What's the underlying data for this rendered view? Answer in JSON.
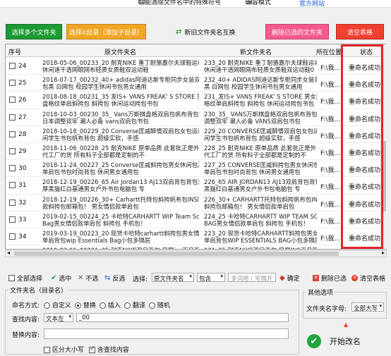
{
  "topbar": {
    "title": "智能清除文件名中的特殊符号",
    "compat_mode": "兼容模式",
    "official": "官方网站"
  },
  "buttons": {
    "select_multi_folders": "选择多个文件夹",
    "select_x_dir": "选择X目录（添加子目录）",
    "swap_old_new": "新旧文件夹名互换",
    "delete_selected": "删除已选的文件夹",
    "clear_table": "清空表格"
  },
  "table": {
    "headers": {
      "seq": "序号",
      "original": "原文件夹名",
      "new": "新文件夹名",
      "location": "所在位置",
      "status": "状态"
    },
    "rows": [
      {
        "num": "24",
        "orig1": "2018-05-06_00233_20 耐克NIKE 重丁耐骆嘉尔夫球鞋运动",
        "orig2": "休闲速干透网眼网布轻质女质鞋双运动鞋",
        "new1": "233_20 耐克NIKE 重丁耐骆嘉尔夫球鞋运动",
        "new2": "休闲速干透网眼网布轻质女质鞋双运动鞋0",
        "pos": "F:\\我...",
        "status": "重命名成功"
      },
      {
        "num": "25",
        "orig1": "2018-07-17_00232_40+ adidas阿迪达斯专柜同步女装双肩",
        "orig2": "包黑 白网包 校园学生休闲书包男女通用",
        "new1": "232_40+ ADIDAS阿迪达斯专柜同步女装双肩包",
        "new2": "黑 白网包 校园学生休闲书包男女通用",
        "pos": "F:\\我...",
        "status": "重命名成功"
      },
      {
        "num": "26",
        "orig1": "2018-08-18_00231_35 发IS+ VANS FREAK' S STORE 男女款棋",
        "orig2": "盘格纹单肩斜挎包 斜挎包 休闲运动挎包书包",
        "new1": "231_发IS+ VANS FREAK' S STORE 男女款棋盘",
        "new2": "格纹单肩斜挎包 斜挎包 休闲运动挎包书包",
        "pos": "F:\\我...",
        "status": "重命名成功"
      },
      {
        "num": "27",
        "orig1": "2018-10-03_00230_35_ Vans万斯棋盘格双肩包帆布背包",
        "orig2": "日本调整双牢 潮人必备 vans双肩包书包",
        "new1": "230_35_ VANS万斯棋盘格双肩包帆布背包日本",
        "new2": "调整双牢 潮人必备 VANS双肩包书包",
        "pos": "F:\\我...",
        "status": "重命名成功"
      },
      {
        "num": "28",
        "orig1": "2018-10-18_00229_20 Converse匡威醉情双肩包女包运动休",
        "orig2": "闲学生书包帆布背包 超级实软，手感",
        "new1": "229_20 CONVERSE匡威醉情双肩包女包运动休",
        "new2": "闲学生书包帆布背包 超级实软，手感",
        "pos": "F:\\我...",
        "status": "重命名成功"
      },
      {
        "num": "29",
        "orig1": "2018-11-06_00228_25 耐克NIKE 原单品质 此套批正是外贸",
        "orig2": "代工厂的货 所有料子全部都是定制的不",
        "new1": "228_25 耐克NIKE 原单品质 此套批正是外贸",
        "new2": "代工厂的货 所有料子全部都是定制的不",
        "pos": "F:\\我...",
        "status": "重命名成功"
      },
      {
        "num": "30",
        "orig1": "2018-11-24_00227_25 Converse匡威斜挎包男女休闲包潮款",
        "orig2": "单肩包书包时尚背包 休闲男女通用包",
        "new1": "227_25 CONVERSE匡威斜挎包男女休闲包潮款",
        "new2": "单肩包书包时尚背包 休闲男女通用包",
        "pos": "F:\\我...",
        "status": "重命名成功"
      },
      {
        "num": "31",
        "orig1": "2018-12-19_00226_65 Air Jordan13 AJ13双肩背包背包双加",
        "orig2": "厚黑猫红白基通男女户外书包电脑包 专",
        "new1": "226_65 AIR JORDAN13 AJ13双肩背包背包双加厚",
        "new2": "黑猫红白基通男女户外书包电脑包 专",
        "pos": "F:\\我...",
        "status": "重命名成功"
      },
      {
        "num": "32",
        "orig1": "2018-12-19_00226_30+ Carhartt托特包斜挎帆布包INS同",
        "orig2": "款斜挎包邮箱包！ 男女情侣款单肩包",
        "new1": "226_30+ CARHARTT托特包斜挎帆布包INS同款",
        "new2": "斜挎包邮箱包！ 男女情侣款单肩包",
        "pos": "F:\\我...",
        "status": "重命名成功"
      },
      {
        "num": "33",
        "orig1": "2019-02-15_00224_25 卡哈特CARHARTT WIP Team Scrip",
        "orig2": "Bag男女情侣款单肩包 斜挎包 手机包！",
        "new1": "224_25 卡哈特CARHARTT WIP TEAM SCRIP",
        "new2": "BAG男女情侣款单肩包 斜挎包 手机包！",
        "pos": "F:\\我...",
        "status": "重命名成功"
      },
      {
        "num": "34",
        "orig1": "2019-03-19_00223_20 现货卡哈特carhartt斜挎包男女情侣",
        "orig2": "单肩背包wip Essentials Bag小包多隔层",
        "new1": "223_20 现货卡哈特CARHARTT斜挎包男女情侣",
        "new2": "单肩背包WIP ESSENTIALS BAG小包多隔层",
        "pos": "F:\\我...",
        "status": "重命名成功"
      },
      {
        "num": "35",
        "orig1": "2019-03-01_00221_35 耐克NIKE双肩背包 风靡ins正品新款",
        "orig2": "时尚耐克nike自信双肩包时尚 情侣书",
        "new1": "221_35 耐克NIKE双肩背包 风靡INS正品新款时",
        "new2": "尚耐克NIKE自信双肩包时尚 情侣书",
        "pos": "F:\\我...",
        "status": "重命名成功"
      },
      {
        "num": "36",
        "orig1": "2019-03-01_00222_20 专柜同步！ Dickies刺绣斜挎包男女",
        "orig2": "同款腰包大学生潮流休闲女士胸包单肩包",
        "new1": "222_20 专柜同步！ DICKIES刺绣斜挎包男女同",
        "new2": "款腰包大学生潮流休闲女士胸包单肩包",
        "pos": "F:\\我...",
        "status": "重命名成功"
      }
    ]
  },
  "toolbar": {
    "select_all": "全部选择",
    "select_checked": "选中",
    "not_selected": "不选",
    "invert": "反选",
    "choose_label": "选择:",
    "field_value": "原文件夹名",
    "contains_value": "包含",
    "multi_placeholder": "多词用 | 号隔开",
    "confirm": "确定",
    "delete_checked": "删除已选",
    "clear_table": "清空表格"
  },
  "options": {
    "group_title": "文件夹名（目录名）",
    "naming_mode_label": "命名方式:",
    "modes": [
      "自定义",
      "替换",
      "插入",
      "翻译",
      "随机"
    ],
    "active_mode": "替换",
    "find_label": "查找内容:",
    "find_type": "文本左",
    "find_value": "_00",
    "replace_label": "替换内容:",
    "replace_value": "",
    "case_sensitive": "区分大小写",
    "include_contains": "含查找内容"
  },
  "other": {
    "group_title": "其他选项",
    "case_label": "文件夹名字母:",
    "case_value": "全部大写"
  },
  "start_button": "开始改名"
}
